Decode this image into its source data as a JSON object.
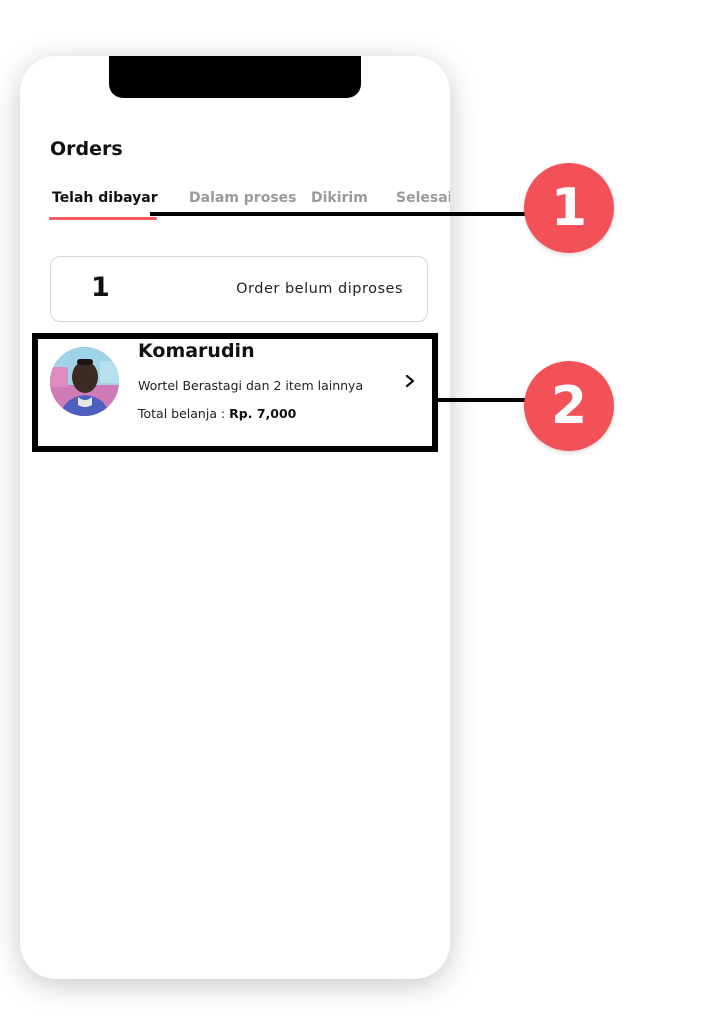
{
  "header": {
    "title": "Orders"
  },
  "tabs": [
    {
      "label": "Telah dibayar",
      "active": true
    },
    {
      "label": "Dalam proses",
      "active": false
    },
    {
      "label": "Dikirim",
      "active": false
    },
    {
      "label": "Selesai",
      "active": false
    }
  ],
  "summary": {
    "count": "1",
    "label": "Order belum diproses"
  },
  "order": {
    "customer_name": "Komarudin",
    "items_text": "Wortel Berastagi dan 2 item lainnya",
    "total_prefix": "Total belanja : ",
    "total_value": "Rp. 7,000",
    "avatar_icon": "user-photo",
    "chevron_icon": "chevron-right-icon"
  },
  "annotations": {
    "badge_1": "1",
    "badge_2": "2"
  },
  "colors": {
    "accent": "#f05a5a",
    "badge": "#f25257",
    "inactive_tab": "#9a9a9a",
    "text": "#111111"
  }
}
